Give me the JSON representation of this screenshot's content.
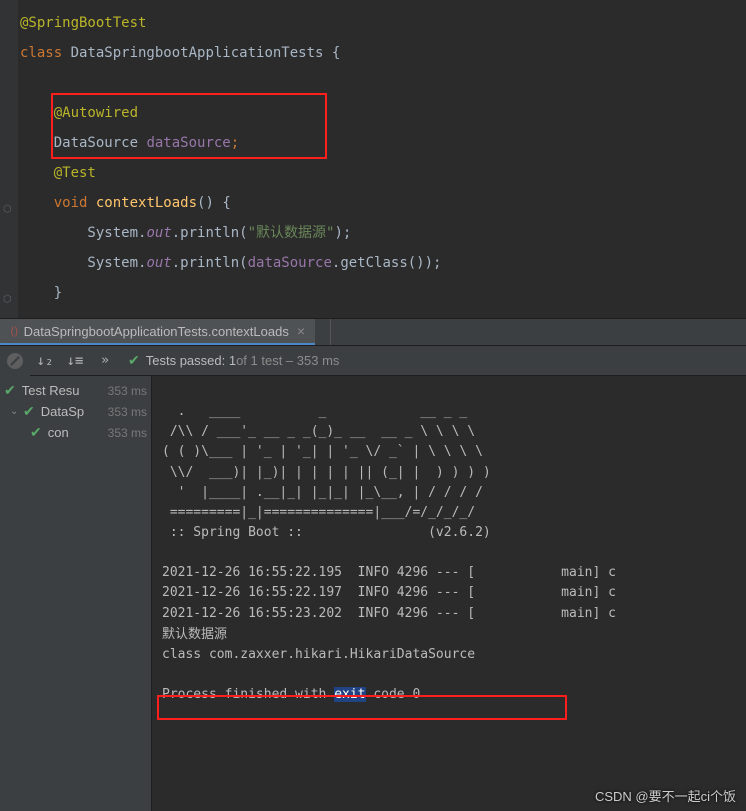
{
  "code": {
    "line1_annotation": "@SpringBootTest",
    "line2_kw": "class ",
    "line2_name": "DataSpringbootApplicationTests ",
    "line2_brace": "{",
    "line4_annotation": "@Autowired",
    "line5_type": "DataSource ",
    "line5_field": "dataSource",
    "line5_semi": ";",
    "line6_annotation": "@Test",
    "line7_kw": "void ",
    "line7_method": "contextLoads",
    "line7_parens": "() {",
    "line8_pre": "        System.",
    "line8_out": "out",
    "line8_println": ".println(",
    "line8_str": "\"默认数据源\"",
    "line8_end": ");",
    "line9_pre": "        System.",
    "line9_out": "out",
    "line9_println": ".println(",
    "line9_ds": "dataSource",
    "line9_get": ".getClass());",
    "line10_brace": "    }"
  },
  "tab": {
    "label": "DataSpringbootApplicationTests.contextLoads"
  },
  "tests": {
    "status_prefix": "Tests passed: 1",
    "status_suffix": " of 1 test – 353 ms",
    "root": "Test Resu",
    "root_time": "353 ms",
    "node1": "DataSp",
    "node1_time": "353 ms",
    "node2": "con",
    "node2_time": "353 ms"
  },
  "console": {
    "ascii1": "  .   ____          _            __ _ _",
    "ascii2": " /\\\\ / ___'_ __ _ _(_)_ __  __ _ \\ \\ \\ \\",
    "ascii3": "( ( )\\___ | '_ | '_| | '_ \\/ _` | \\ \\ \\ \\",
    "ascii4": " \\\\/  ___)| |_)| | | | | || (_| |  ) ) ) )",
    "ascii5": "  '  |____| .__|_| |_|_| |_\\__, | / / / /",
    "ascii6": " =========|_|==============|___/=/_/_/_/",
    "ascii7": " :: Spring Boot ::                (v2.6.2)",
    "log1": "2021-12-26 16:55:22.195  INFO 4296 --- [           main] c",
    "log2": "2021-12-26 16:55:22.197  INFO 4296 --- [           main] c",
    "log3": "2021-12-26 16:55:23.202  INFO 4296 --- [           main] c",
    "out1": "默认数据源",
    "out2": "class com.zaxxer.hikari.HikariDataSource",
    "exit_pre": "Process finished with ",
    "exit_word": "exit",
    "exit_post": " code 0"
  },
  "watermark": "CSDN @要不一起ci个饭"
}
